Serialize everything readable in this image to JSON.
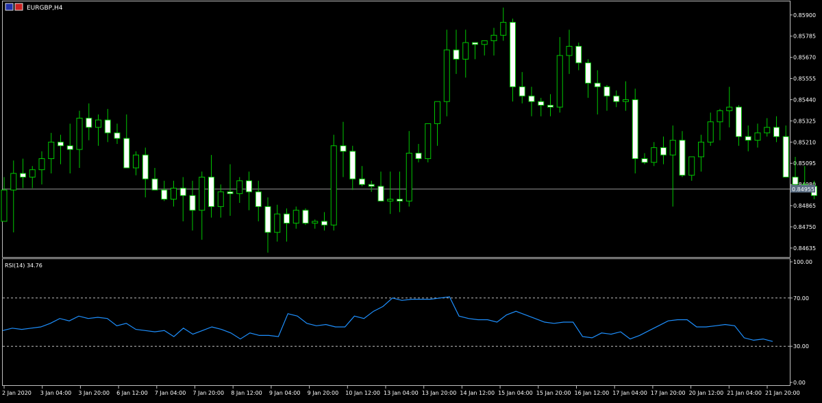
{
  "window": {
    "symbol_label": "EURGBP,H4"
  },
  "colors": {
    "background": "#000000",
    "bull_body": "#000000",
    "bear_body": "#ffffff",
    "wick": "#00c800",
    "bid_line": "#c0c0c0",
    "rsi_line": "#1e90ff",
    "level_line": "#c0c0c0",
    "panel_border": "#c0c0c0"
  },
  "price_axis": {
    "ticks": [
      "0.85900",
      "0.85785",
      "0.85670",
      "0.85555",
      "0.85440",
      "0.85325",
      "0.85210",
      "0.85095",
      "0.84980",
      "0.84865",
      "0.84750",
      "0.84635"
    ],
    "current_price_label": "0.84955"
  },
  "rsi_panel": {
    "label": "RSI(14) 34.76",
    "axis_ticks": [
      "100.00",
      "70.00",
      "30.00",
      "0.00"
    ]
  },
  "time_axis": {
    "labels": [
      "2 Jan 2020",
      "3 Jan 04:00",
      "3 Jan 20:00",
      "6 Jan 12:00",
      "7 Jan 04:00",
      "7 Jan 20:00",
      "8 Jan 12:00",
      "9 Jan 04:00",
      "9 Jan 20:00",
      "10 Jan 12:00",
      "13 Jan 04:00",
      "13 Jan 20:00",
      "14 Jan 12:00",
      "15 Jan 04:00",
      "15 Jan 20:00",
      "16 Jan 12:00",
      "17 Jan 04:00",
      "17 Jan 20:00",
      "20 Jan 12:00",
      "21 Jan 04:00",
      "21 Jan 20:00"
    ]
  },
  "chart_data": [
    {
      "type": "candlestick",
      "title": "EURGBP,H4",
      "ylim": [
        0.8459,
        0.8597
      ],
      "current_price": 0.84955,
      "candles": [
        [
          0.8478,
          0.8502,
          0.8478,
          0.8495
        ],
        [
          0.8495,
          0.8511,
          0.8472,
          0.8504
        ],
        [
          0.8504,
          0.8512,
          0.8496,
          0.8502
        ],
        [
          0.8502,
          0.8508,
          0.8496,
          0.8506
        ],
        [
          0.8506,
          0.8516,
          0.8498,
          0.8512
        ],
        [
          0.8512,
          0.8526,
          0.8504,
          0.8521
        ],
        [
          0.8521,
          0.8525,
          0.8509,
          0.8519
        ],
        [
          0.8519,
          0.8531,
          0.8504,
          0.8517
        ],
        [
          0.8517,
          0.8538,
          0.8507,
          0.8534
        ],
        [
          0.8534,
          0.8542,
          0.8522,
          0.8529
        ],
        [
          0.8529,
          0.8536,
          0.8519,
          0.8533
        ],
        [
          0.8533,
          0.8539,
          0.8521,
          0.8526
        ],
        [
          0.8526,
          0.8531,
          0.852,
          0.8523
        ],
        [
          0.8523,
          0.8536,
          0.8509,
          0.8507
        ],
        [
          0.8507,
          0.8516,
          0.8503,
          0.8514
        ],
        [
          0.8514,
          0.8518,
          0.8491,
          0.8501
        ],
        [
          0.8501,
          0.8507,
          0.8496,
          0.8495
        ],
        [
          0.8495,
          0.85,
          0.8489,
          0.849
        ],
        [
          0.849,
          0.85,
          0.8486,
          0.8496
        ],
        [
          0.8496,
          0.8502,
          0.8478,
          0.8492
        ],
        [
          0.8492,
          0.85,
          0.8473,
          0.8484
        ],
        [
          0.8484,
          0.8505,
          0.8468,
          0.8502
        ],
        [
          0.8502,
          0.8514,
          0.848,
          0.8486
        ],
        [
          0.8486,
          0.8498,
          0.848,
          0.8494
        ],
        [
          0.8494,
          0.8509,
          0.8481,
          0.8493
        ],
        [
          0.8493,
          0.8502,
          0.8488,
          0.85
        ],
        [
          0.85,
          0.8505,
          0.8484,
          0.8494
        ],
        [
          0.8494,
          0.85,
          0.8478,
          0.8486
        ],
        [
          0.8486,
          0.8491,
          0.8461,
          0.8472
        ],
        [
          0.8472,
          0.8487,
          0.8467,
          0.8482
        ],
        [
          0.8482,
          0.8485,
          0.8467,
          0.8477
        ],
        [
          0.8477,
          0.8486,
          0.8474,
          0.8484
        ],
        [
          0.8484,
          0.8485,
          0.8476,
          0.8477
        ],
        [
          0.8477,
          0.8479,
          0.8474,
          0.8478
        ],
        [
          0.8478,
          0.8483,
          0.8473,
          0.8476
        ],
        [
          0.8476,
          0.8525,
          0.8473,
          0.8519
        ],
        [
          0.8519,
          0.8532,
          0.8502,
          0.8516
        ],
        [
          0.8516,
          0.8519,
          0.8495,
          0.8501
        ],
        [
          0.8501,
          0.8508,
          0.8497,
          0.8498
        ],
        [
          0.8498,
          0.85,
          0.8494,
          0.8497
        ],
        [
          0.8497,
          0.8505,
          0.849,
          0.8489
        ],
        [
          0.8489,
          0.8505,
          0.8482,
          0.849
        ],
        [
          0.849,
          0.8505,
          0.8483,
          0.8489
        ],
        [
          0.8489,
          0.8527,
          0.8486,
          0.8515
        ],
        [
          0.8515,
          0.852,
          0.851,
          0.8512
        ],
        [
          0.8512,
          0.8523,
          0.851,
          0.8531
        ],
        [
          0.8531,
          0.8535,
          0.8519,
          0.8543
        ],
        [
          0.8543,
          0.8582,
          0.8535,
          0.8571
        ],
        [
          0.8571,
          0.8582,
          0.8558,
          0.8566
        ],
        [
          0.8566,
          0.8582,
          0.8556,
          0.8575
        ],
        [
          0.8575,
          0.8575,
          0.8566,
          0.8574
        ],
        [
          0.8574,
          0.8576,
          0.8568,
          0.8576
        ],
        [
          0.8576,
          0.8583,
          0.8568,
          0.8579
        ],
        [
          0.8579,
          0.8594,
          0.8576,
          0.8586
        ],
        [
          0.8586,
          0.8588,
          0.8543,
          0.8551
        ],
        [
          0.8551,
          0.8559,
          0.8542,
          0.8546
        ],
        [
          0.8546,
          0.8551,
          0.8535,
          0.8543
        ],
        [
          0.8543,
          0.8545,
          0.8535,
          0.8541
        ],
        [
          0.8541,
          0.8547,
          0.8535,
          0.854
        ],
        [
          0.854,
          0.8578,
          0.8537,
          0.8568
        ],
        [
          0.8568,
          0.8582,
          0.8558,
          0.8573
        ],
        [
          0.8573,
          0.8575,
          0.856,
          0.8564
        ],
        [
          0.8564,
          0.8566,
          0.8545,
          0.8553
        ],
        [
          0.8553,
          0.856,
          0.8536,
          0.8551
        ],
        [
          0.8551,
          0.8552,
          0.8538,
          0.8546
        ],
        [
          0.8546,
          0.8549,
          0.854,
          0.8543
        ],
        [
          0.8543,
          0.8554,
          0.8538,
          0.8544
        ],
        [
          0.8544,
          0.855,
          0.8504,
          0.8512
        ],
        [
          0.8512,
          0.8515,
          0.8509,
          0.851
        ],
        [
          0.851,
          0.8521,
          0.8508,
          0.8518
        ],
        [
          0.8518,
          0.8524,
          0.8509,
          0.8514
        ],
        [
          0.8514,
          0.853,
          0.8486,
          0.8522
        ],
        [
          0.8522,
          0.8527,
          0.8502,
          0.8503
        ],
        [
          0.8503,
          0.8513,
          0.85,
          0.8513
        ],
        [
          0.8513,
          0.8525,
          0.8505,
          0.8521
        ],
        [
          0.8521,
          0.8537,
          0.8519,
          0.8532
        ],
        [
          0.8532,
          0.8539,
          0.8522,
          0.8538
        ],
        [
          0.8538,
          0.8551,
          0.8529,
          0.854
        ],
        [
          0.854,
          0.8541,
          0.8519,
          0.8524
        ],
        [
          0.8524,
          0.853,
          0.8516,
          0.8522
        ],
        [
          0.8522,
          0.8531,
          0.8518,
          0.8526
        ],
        [
          0.8526,
          0.8534,
          0.8524,
          0.8529
        ],
        [
          0.8529,
          0.8535,
          0.8521,
          0.8524
        ],
        [
          0.8524,
          0.853,
          0.8503,
          0.8502
        ],
        [
          0.8502,
          0.8513,
          0.8496,
          0.8498
        ],
        [
          0.8498,
          0.8508,
          0.8494,
          0.8497
        ],
        [
          0.8497,
          0.85,
          0.849,
          0.8492
        ]
      ]
    },
    {
      "type": "line",
      "title": "RSI(14) 34.76",
      "ylim": [
        0,
        100
      ],
      "levels": [
        30,
        70
      ],
      "values": [
        43,
        45,
        44,
        45,
        46,
        49,
        53,
        51,
        55,
        53,
        54,
        53,
        47,
        49,
        44,
        43,
        42,
        43,
        38,
        45,
        40,
        43,
        46,
        44,
        41,
        36,
        41,
        39,
        39,
        38,
        57,
        55,
        49,
        47,
        48,
        46,
        46,
        55,
        53,
        59,
        63,
        70,
        68,
        69,
        69,
        69,
        70,
        71,
        55,
        53,
        52,
        52,
        50,
        56,
        59,
        56,
        53,
        50,
        49,
        50,
        50,
        38,
        37,
        41,
        40,
        42,
        36,
        39,
        43,
        47,
        51,
        52,
        52,
        46,
        46,
        47,
        48,
        47,
        37,
        35,
        36,
        34
      ]
    }
  ]
}
